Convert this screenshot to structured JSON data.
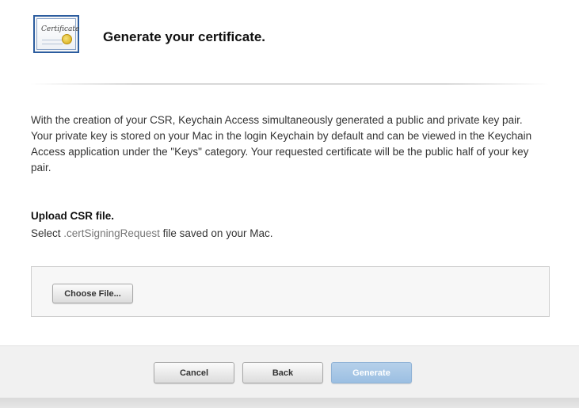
{
  "header": {
    "icon": "certificate-icon",
    "icon_text": "Certificate",
    "title": "Generate your certificate."
  },
  "description": "With the creation of your CSR, Keychain Access simultaneously generated a public and private key pair. Your private key is stored on your Mac in the login Keychain by default and can be viewed in the Keychain Access application under the \"Keys\" category. Your requested certificate will be the public half of your key pair.",
  "upload": {
    "title": "Upload CSR file.",
    "hint_prefix": "Select",
    "hint_extension": ".certSigningRequest",
    "hint_suffix": "file saved on your Mac.",
    "choose_label": "Choose File..."
  },
  "footer": {
    "cancel_label": "Cancel",
    "back_label": "Back",
    "generate_label": "Generate"
  },
  "colors": {
    "primary_disabled": "#9bbfe2",
    "icon_border": "#2c5d9f",
    "seal": "#d4a60e"
  }
}
